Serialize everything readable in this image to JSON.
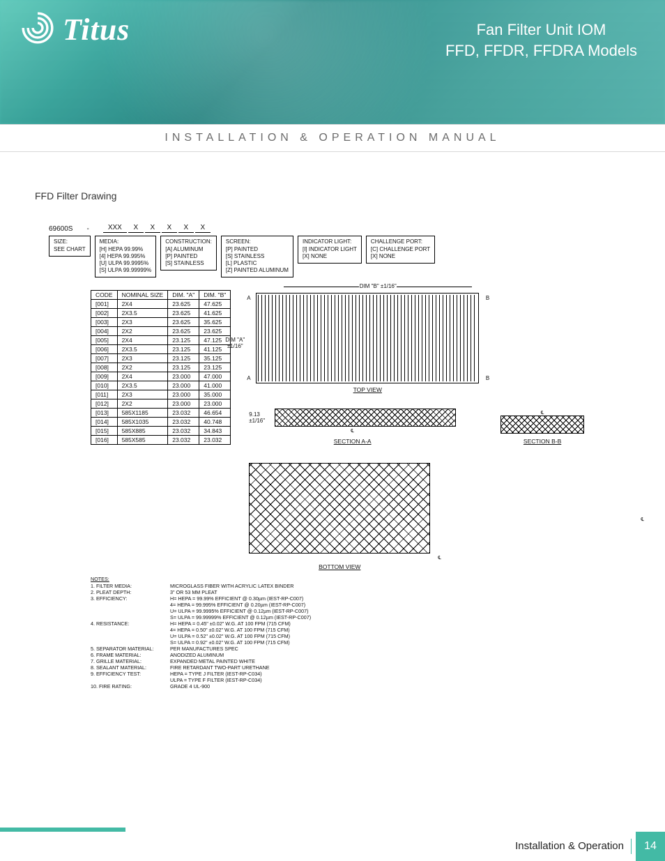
{
  "brand": {
    "name": "Titus"
  },
  "header": {
    "title_line1": "Fan Filter Unit IOM",
    "title_line2": "FFD, FFDR, FFDRA Models"
  },
  "subheader": "INSTALLATION & OPERATION MANUAL",
  "section_heading": "FFD Filter Drawing",
  "part_number": {
    "base": "69600S",
    "dash": "-",
    "slots": [
      "XXX",
      "X",
      "X",
      "X",
      "X",
      "X"
    ]
  },
  "decode": {
    "size": {
      "label": "SIZE:",
      "sub": "SEE CHART",
      "options": []
    },
    "media": {
      "label": "MEDIA:",
      "options": [
        "[H] HEPA 99.99%",
        "[4] HEPA 99.995%",
        "[U] ULPA 99.9995%",
        "[S] ULPA 99.99999%"
      ]
    },
    "construction": {
      "label": "CONSTRUCTION:",
      "options": [
        "[A] ALUMINUM",
        "[P] PAINTED",
        "[S] STAINLESS"
      ]
    },
    "screen": {
      "label": "SCREEN:",
      "options": [
        "[P] PAINTED",
        "[S] STAINLESS",
        "[L] PLASTIC",
        "[Z] PAINTED ALUMINUM"
      ]
    },
    "indicator": {
      "label": "INDICATOR LIGHT:",
      "options": [
        "[I] INDICATOR LIGHT",
        "[X] NONE"
      ]
    },
    "challenge": {
      "label": "CHALLENGE PORT:",
      "options": [
        "[C] CHALLENGE PORT",
        "[X] NONE"
      ]
    }
  },
  "dim_table": {
    "headers": [
      "CODE",
      "NOMINAL SIZE",
      "DIM. \"A\"",
      "DIM. \"B\""
    ],
    "rows": [
      [
        "[001]",
        "2X4",
        "23.625",
        "47.625"
      ],
      [
        "[002]",
        "2X3.5",
        "23.625",
        "41.625"
      ],
      [
        "[003]",
        "2X3",
        "23.625",
        "35.625"
      ],
      [
        "[004]",
        "2X2",
        "23.625",
        "23.625"
      ],
      [
        "[005]",
        "2X4",
        "23.125",
        "47.125"
      ],
      [
        "[006]",
        "2X3.5",
        "23.125",
        "41.125"
      ],
      [
        "[007]",
        "2X3",
        "23.125",
        "35.125"
      ],
      [
        "[008]",
        "2X2",
        "23.125",
        "23.125"
      ],
      [
        "[009]",
        "2X4",
        "23.000",
        "47.000"
      ],
      [
        "[010]",
        "2X3.5",
        "23.000",
        "41.000"
      ],
      [
        "[011]",
        "2X3",
        "23.000",
        "35.000"
      ],
      [
        "[012]",
        "2X2",
        "23.000",
        "23.000"
      ],
      [
        "[013]",
        "585X1185",
        "23.032",
        "46.654"
      ],
      [
        "[014]",
        "585X1035",
        "23.032",
        "40.748"
      ],
      [
        "[015]",
        "585X885",
        "23.032",
        "34.843"
      ],
      [
        "[016]",
        "585X585",
        "23.032",
        "23.032"
      ]
    ]
  },
  "notes": {
    "title": "NOTES:",
    "items": [
      {
        "n": "1.",
        "label": "FILTER MEDIA:",
        "vals": [
          "MICROGLASS FIBER WITH ACRYLIC LATEX BINDER"
        ]
      },
      {
        "n": "2.",
        "label": "PLEAT DEPTH:",
        "vals": [
          "3\" OR 53 MM PLEAT"
        ]
      },
      {
        "n": "3.",
        "label": "EFFICIENCY:",
        "vals": [
          "H= HEPA = 99.99% EFFICIENT @ 0.30µm (IEST-RP-C007)",
          "4= HEPA = 99.995% EFFICIENT @ 0.20µm (IEST-RP-C007)",
          "U= ULPA = 99.9995% EFFICIENT @ 0.12µm (IEST-RP-C007)",
          "S= ULPA = 99.99999% EFFICIENT @ 0.12µm (IEST-RP-C007)"
        ]
      },
      {
        "n": "4.",
        "label": "RESISTANCE:",
        "vals": [
          "H= HEPA = 0.45\" ±0.02\" W.G. AT 100 FPM (715 CFM)",
          "4= HEPA = 0.50\" ±0.02\" W.G. AT 100 FPM (715 CFM)",
          "U= ULPA = 0.52\" ±0.02\" W.G. AT 100 FPM (715 CFM)",
          "S= ULPA = 0.92\" ±0.02\" W.G. AT 100 FPM (715 CFM)"
        ]
      },
      {
        "n": "5.",
        "label": "SEPARATOR MATERIAL:",
        "vals": [
          "PER MANUFACTURES SPEC"
        ]
      },
      {
        "n": "6.",
        "label": "FRAME MATERIAL:",
        "vals": [
          "ANODIZED ALUMINUM"
        ]
      },
      {
        "n": "7.",
        "label": "GRILLE MATERIAL:",
        "vals": [
          "EXPANDED METAL PAINTED WHITE"
        ]
      },
      {
        "n": "8.",
        "label": "SEALANT MATERIAL:",
        "vals": [
          "FIRE RETARDANT TWO-PART URETHANE"
        ]
      },
      {
        "n": "9.",
        "label": "EFFICIENCY TEST:",
        "vals": [
          "HEPA = TYPE J FILTER (IEST-RP-C034)",
          "ULPA = TYPE F FILTER (IEST-RP-C034)"
        ]
      },
      {
        "n": "10.",
        "label": "FIRE RATING:",
        "vals": [
          "GRADE 4 UL-900"
        ]
      }
    ]
  },
  "diagram": {
    "dim_b": "DIM \"B\" ±1/16\"",
    "dim_a": "DIM \"A\"\n±1/16\"",
    "top_view": "TOP VIEW",
    "section_aa": "SECTION A-A",
    "section_bb": "SECTION B-B",
    "bottom_view": "BOTTOM VIEW",
    "section_dim": "9.13\n±1/16\"",
    "cl": "℄",
    "a": "A",
    "b": "B"
  },
  "footer": {
    "text": "Installation & Operation",
    "page": "14"
  }
}
